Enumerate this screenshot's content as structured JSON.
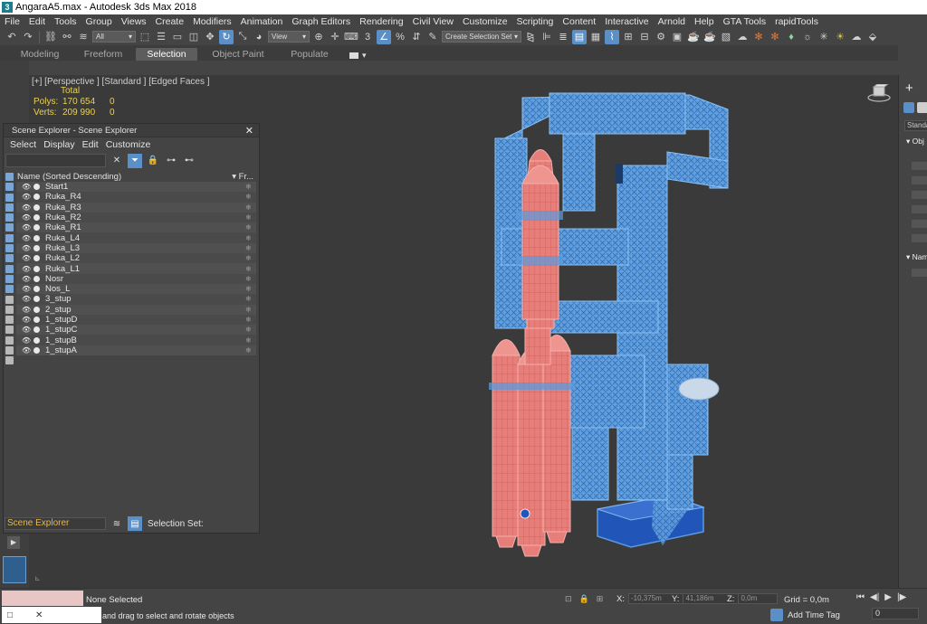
{
  "window": {
    "title": "AngaraA5.max - Autodesk 3ds Max 2018",
    "app_icon": "3"
  },
  "menu": [
    "File",
    "Edit",
    "Tools",
    "Group",
    "Views",
    "Create",
    "Modifiers",
    "Animation",
    "Graph Editors",
    "Rendering",
    "Civil View",
    "Customize",
    "Scripting",
    "Content",
    "Interactive",
    "Arnold",
    "Help",
    "GTA Tools",
    "rapidTools"
  ],
  "toolbar": {
    "filter_value": "All",
    "ref_coord_value": "View",
    "selection_set_placeholder": "Create Selection Set",
    "numeric_label": "3"
  },
  "ribbon": {
    "tabs": [
      "Modeling",
      "Freeform",
      "Selection",
      "Object Paint",
      "Populate"
    ],
    "active_tab": "Selection"
  },
  "viewport": {
    "label": "[+] [Perspective ] [Standard ] [Edged Faces ]",
    "stats": {
      "total_label": "Total",
      "polys_label": "Polys:",
      "polys_total": "170 654",
      "polys_sel": "0",
      "verts_label": "Verts:",
      "verts_total": "209 990",
      "verts_sel": "0"
    }
  },
  "scene_explorer": {
    "title": "Scene Explorer - Scene Explorer",
    "menu": [
      "Select",
      "Display",
      "Edit",
      "Customize"
    ],
    "column_name": "Name (Sorted Descending)",
    "column_frozen": "▾ Fr...",
    "objects": [
      "Start1",
      "Ruka_R4",
      "Ruka_R3",
      "Ruka_R2",
      "Ruka_R1",
      "Ruka_L4",
      "Ruka_L3",
      "Ruka_L2",
      "Ruka_L1",
      "Nosr",
      "Nos_L",
      "3_stup",
      "2_stup",
      "1_stupD",
      "1_stupC",
      "1_stupB",
      "1_stupA"
    ],
    "footer_explorer": "Scene Explorer",
    "footer_selection_set": "Selection Set:"
  },
  "command_panel": {
    "standard": "Standar",
    "object_type_label": "Obj",
    "name_color_label": "Nam"
  },
  "status": {
    "selection": "None Selected",
    "prompt": "and drag to select and rotate objects",
    "x_label": "X:",
    "x_value": "-10,375m",
    "y_label": "Y:",
    "y_value": "41,186m",
    "z_label": "Z:",
    "z_value": "0,0m",
    "grid": "Grid = 0,0m",
    "add_time_tag": "Add Time Tag",
    "frame": "0"
  },
  "colors": {
    "background": "#444444",
    "viewport_bg": "#3a3a3a",
    "accent_blue": "#5b8fc7",
    "stats_yellow": "#e8d15a",
    "rocket_red": "#e87e79",
    "tower_blue": "#5a9be0",
    "base_blue": "#2255b8"
  }
}
